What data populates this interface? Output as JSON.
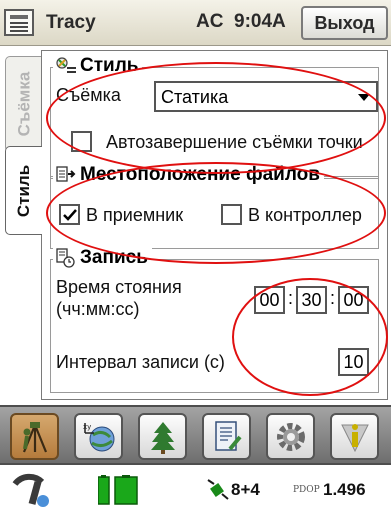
{
  "titlebar": {
    "app_name": "Tracy",
    "power": "AC",
    "time": "9:04A",
    "exit_label": "Выход"
  },
  "side_tabs": [
    {
      "label": "Съёмка",
      "active": false
    },
    {
      "label": "Стиль",
      "active": true
    }
  ],
  "style_group": {
    "title": "Стиль",
    "survey_label": "Съёмка",
    "survey_value": "Статика",
    "auto_finish_label": "Автозавершение съёмки точки",
    "auto_finish_checked": false
  },
  "files_group": {
    "title": "Местоположение файлов",
    "receiver_label": "В приемник",
    "receiver_checked": true,
    "controller_label": "В контроллер",
    "controller_checked": false
  },
  "record_group": {
    "title": "Запись",
    "stay_time_label_line1": "Время стояния",
    "stay_time_label_line2": "(чч:мм:сс)",
    "hours": "00",
    "minutes": "30",
    "seconds": "00",
    "interval_label": "Интервал записи (с)",
    "interval_value": "10"
  },
  "toolbar": {
    "buttons": [
      {
        "icon": "surveyor-icon",
        "active": true
      },
      {
        "icon": "coordinate-system-icon",
        "active": false
      },
      {
        "icon": "tree-icon",
        "active": false
      },
      {
        "icon": "notebook-icon",
        "active": false
      },
      {
        "icon": "gear-icon",
        "active": false
      },
      {
        "icon": "info-icon",
        "active": false
      }
    ]
  },
  "statusbar": {
    "satellites": "8+4",
    "pdop_label": "PDOP",
    "pdop_value": "1.496"
  },
  "colors": {
    "annotation_red": "#e01010",
    "toolbar_active": "#c08a4c"
  }
}
